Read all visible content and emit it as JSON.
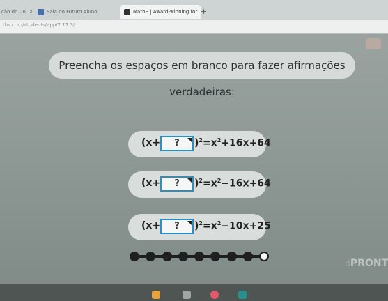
{
  "browser": {
    "tabs": [
      {
        "title": "ção do Co",
        "close": "✕"
      },
      {
        "title": "Sala do Futuro Aluno",
        "close": "✕"
      },
      {
        "title": "MathE | Award-winning for",
        "close": "✕"
      }
    ],
    "new_tab": "+",
    "url": "ths.com/students/app/7.17.3/"
  },
  "instruction": "Preencha os espaços em branco para fazer afirmações verdadeiras:",
  "equations": [
    {
      "left": "(x+",
      "blank": "?",
      "right_paren": ")",
      "exponent": "2",
      "rhs_a": "=x",
      "rhs_exp": "2",
      "rhs_b": "+16x+64"
    },
    {
      "left": "(x+",
      "blank": "?",
      "right_paren": ")",
      "exponent": "2",
      "rhs_a": "=x",
      "rhs_exp": "2",
      "rhs_b": "−16x+64"
    },
    {
      "left": "(x+",
      "blank": "?",
      "right_paren": ")",
      "exponent": "2",
      "rhs_a": "=x",
      "rhs_exp": "2",
      "rhs_b": "−10x+25"
    }
  ],
  "progress": {
    "total": 9,
    "completed": 8
  },
  "ready_label": "PRONTO",
  "colors": {
    "blank_border": "#2b8fc1",
    "accent_icon": "#2a8f8a"
  }
}
